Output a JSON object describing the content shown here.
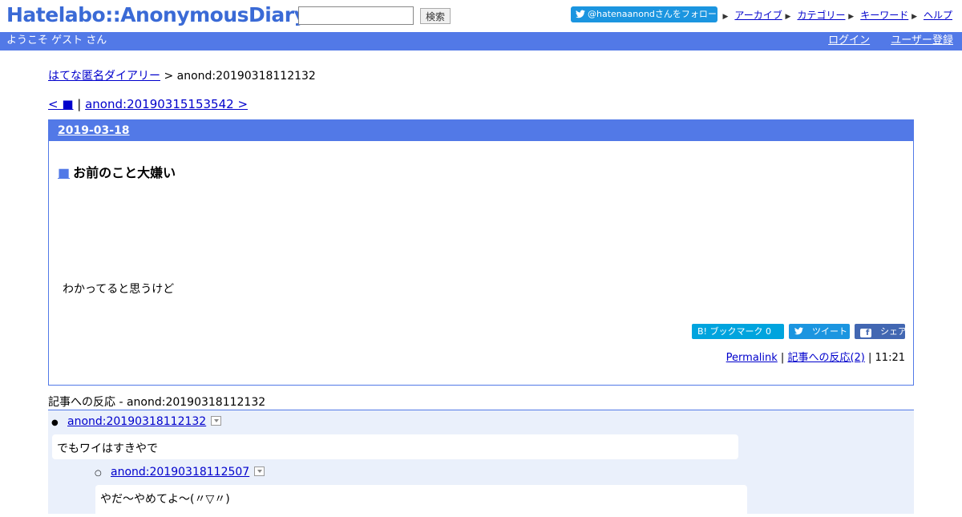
{
  "header": {
    "logo": "Hatelabo::AnonymousDiary",
    "search_placeholder": "",
    "search_button": "検索",
    "follow_label": "@hatenaanondさんをフォロー",
    "links": [
      "アーカイブ",
      "カテゴリー",
      "キーワード",
      "ヘルプ"
    ]
  },
  "bar": {
    "welcome": "ようこそ ゲスト さん",
    "login": "ログイン",
    "register": "ユーザー登録"
  },
  "breadcrumb": {
    "home": "はてな匿名ダイアリー",
    "separator": " > ",
    "current": "anond:20190318112132"
  },
  "pager": {
    "prev": "< ■",
    "sep": " | ",
    "next": "anond:20190315153542 >"
  },
  "article": {
    "date": "2019-03-18",
    "title_marker": "■",
    "title": "お前のこと大嫌い",
    "body": "わかってると思うけど",
    "share": {
      "hatena": "B! ブックマーク  0",
      "tweet": "ツイート",
      "facebook": "シェア"
    },
    "permalink": "Permalink",
    "reactions_link": "記事への反応(2)",
    "time": "11:21"
  },
  "reactions": {
    "title": "記事への反応 - anond:20190318112132",
    "items": [
      {
        "id": "anond:20190318112132",
        "text": "でもワイはすきやで"
      },
      {
        "id": "anond:20190318112507",
        "text": "やだ～やめてよ～(〃▽〃)"
      }
    ]
  },
  "colors": {
    "accent": "#5279e7",
    "logo": "#3a6ad6",
    "twitter": "#1b95e0",
    "hatena": "#00a4de",
    "facebook": "#4267b2"
  }
}
